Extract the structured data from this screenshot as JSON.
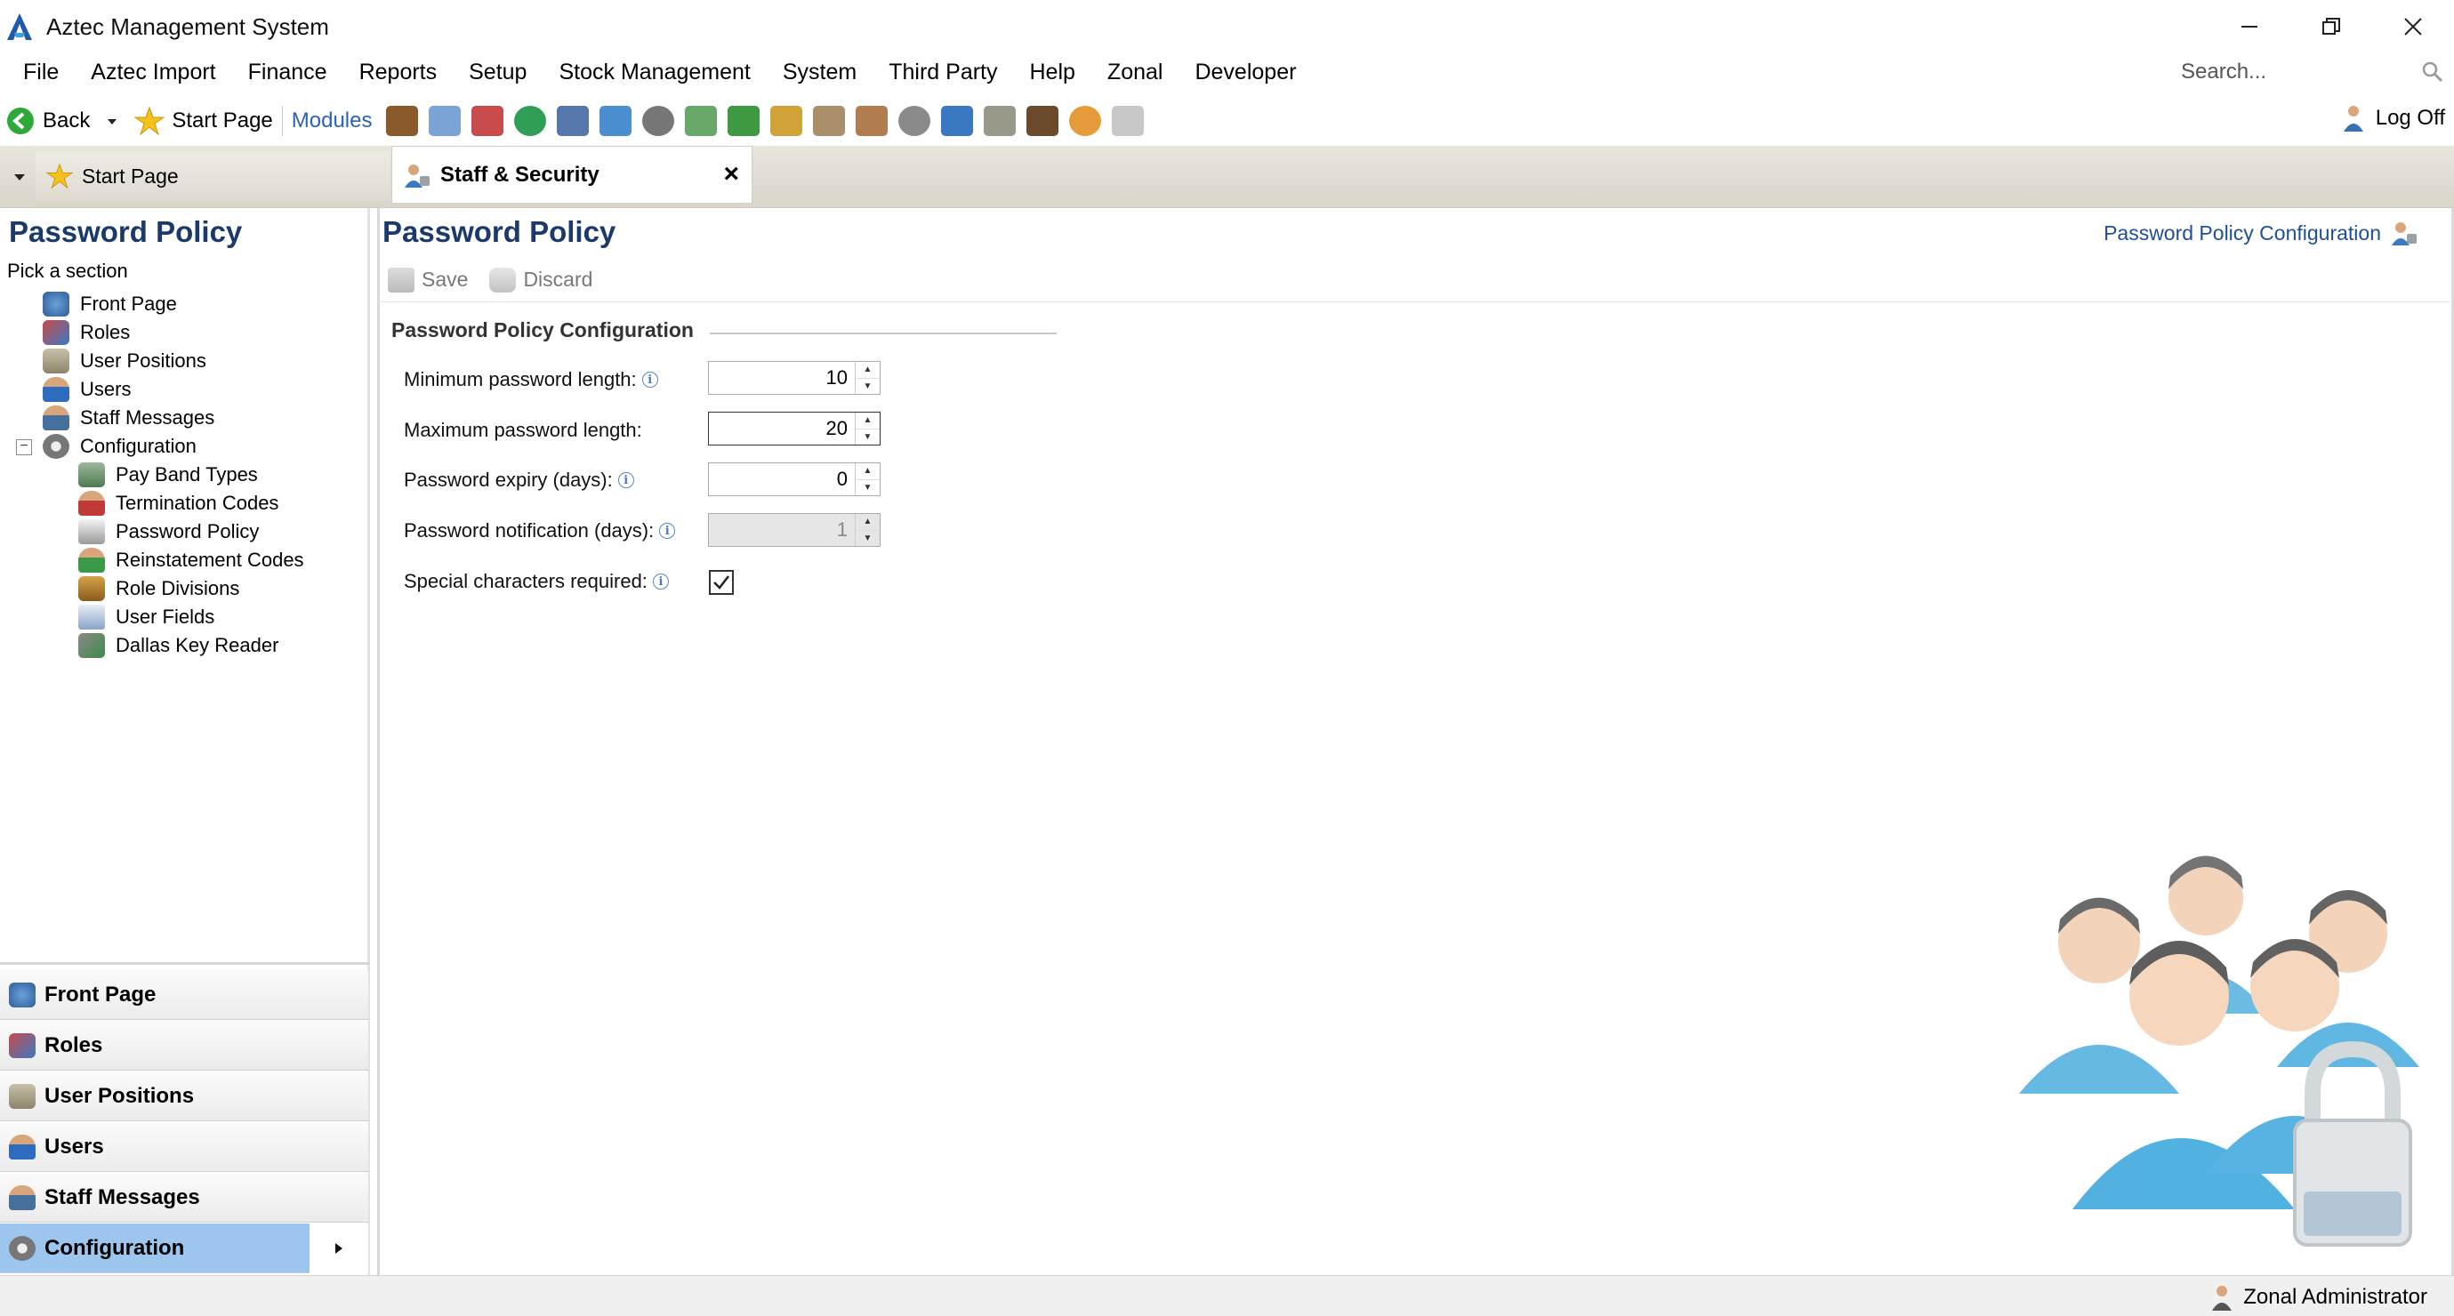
{
  "window": {
    "title": "Aztec Management System"
  },
  "menu": [
    "File",
    "Aztec Import",
    "Finance",
    "Reports",
    "Setup",
    "Stock Management",
    "System",
    "Third Party",
    "Help",
    "Zonal",
    "Developer"
  ],
  "search": {
    "placeholder": "Search..."
  },
  "toolbar": {
    "back_label": "Back",
    "start_page_label": "Start Page",
    "modules_label": "Modules",
    "logoff_label": "Log Off"
  },
  "tabs": {
    "start_page": "Start Page",
    "staff_security": "Staff & Security"
  },
  "left": {
    "title": "Password Policy",
    "subtitle": "Pick a section",
    "tree": [
      "Front Page",
      "Roles",
      "User Positions",
      "Users",
      "Staff Messages",
      "Configuration"
    ],
    "config_children": [
      "Pay Band Types",
      "Termination Codes",
      "Password Policy",
      "Reinstatement Codes",
      "Role Divisions",
      "User Fields",
      "Dallas Key Reader"
    ],
    "nav": [
      "Front Page",
      "Roles",
      "User Positions",
      "Users",
      "Staff Messages",
      "Configuration"
    ]
  },
  "main": {
    "title": "Password Policy",
    "header_link": "Password Policy Configuration",
    "save_label": "Save",
    "discard_label": "Discard",
    "section_title": "Password Policy Configuration",
    "fields": {
      "min_length": {
        "label": "Minimum password length:",
        "value": "10"
      },
      "max_length": {
        "label": "Maximum password length:",
        "value": "20"
      },
      "expiry": {
        "label": "Password expiry (days):",
        "value": "0"
      },
      "notification": {
        "label": "Password notification (days):",
        "value": "1"
      },
      "special": {
        "label": "Special characters required:",
        "checked": true
      }
    }
  },
  "status": {
    "user": "Zonal Administrator"
  },
  "colors": {
    "title_blue": "#1b3a6b",
    "active_nav": "#9cc6ee",
    "link_blue": "#1f4f95"
  }
}
